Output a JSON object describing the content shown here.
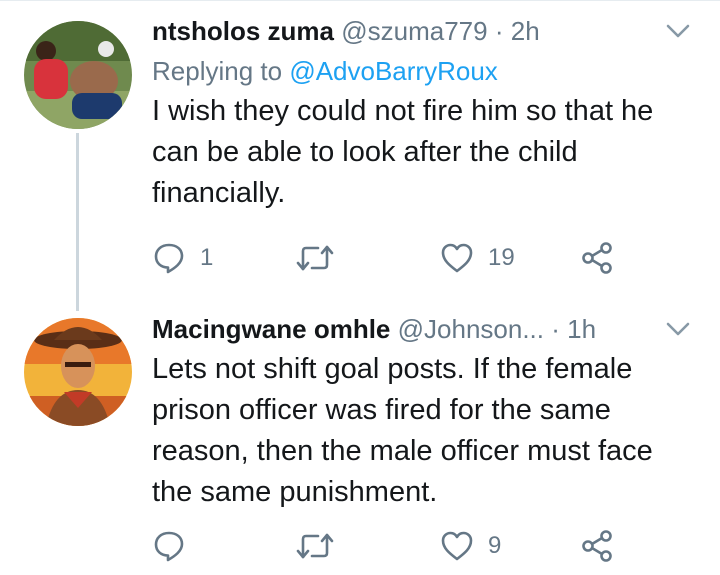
{
  "tweets": [
    {
      "display_name": "ntsholos zuma",
      "handle": "@szuma779",
      "time": "2h",
      "separator": "·",
      "reply_prefix": "Replying to",
      "reply_mention": "@AdvoBarryRoux",
      "text": "I wish they could not fire him so that he can be able to look after the child financially.",
      "reply_count": "1",
      "retweet_count": "",
      "like_count": "19",
      "icons": [
        "reply-icon",
        "retweet-icon",
        "like-icon",
        "share-icon",
        "chevron-down-icon"
      ]
    },
    {
      "display_name": "Macingwane omhle",
      "handle": "@Johnson...",
      "time": "1h",
      "separator": "·",
      "text": "Lets not shift goal posts. If the female prison officer was fired for the same reason, then the male officer must face the same punishment.",
      "reply_count": "",
      "retweet_count": "",
      "like_count": "9",
      "icons": [
        "reply-icon",
        "retweet-icon",
        "like-icon",
        "share-icon",
        "chevron-down-icon"
      ]
    }
  ],
  "colors": {
    "text": "#14171a",
    "secondary": "#657786",
    "link": "#1da1f2",
    "thread_line": "#ccd6dd"
  }
}
